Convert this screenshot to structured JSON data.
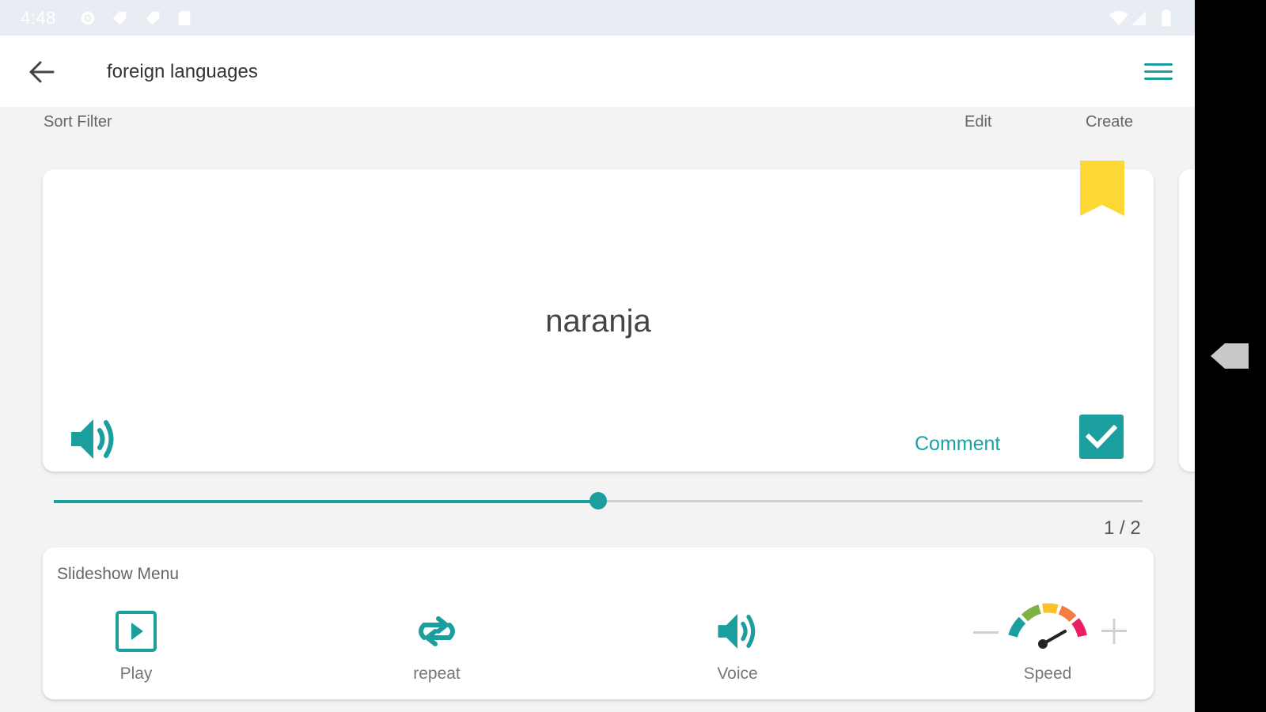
{
  "status_bar": {
    "time": "4:48",
    "icons": [
      "gear-icon",
      "tag-icon",
      "tag-icon",
      "sd-card-icon",
      "wifi-icon",
      "signal-icon",
      "battery-icon"
    ]
  },
  "app_bar": {
    "title": "foreign languages",
    "back_icon": "arrow-left-icon",
    "menu_icon": "hamburger-menu-icon"
  },
  "toolbar": {
    "sort_filter": "Sort Filter",
    "edit": "Edit",
    "create": "Create"
  },
  "card": {
    "word": "naranja",
    "comment_label": "Comment",
    "bookmarked": true,
    "checked": true
  },
  "progress": {
    "current": 1,
    "total": 2,
    "label": "1 / 2",
    "position": 0.5
  },
  "slideshow_menu": {
    "title": "Slideshow Menu",
    "items": [
      {
        "label": "Play",
        "icon": "play-icon"
      },
      {
        "label": "repeat",
        "icon": "repeat-icon"
      },
      {
        "label": "Voice",
        "icon": "speaker-icon"
      }
    ],
    "speed": {
      "label": "Speed",
      "icon": "speedometer-icon"
    }
  },
  "colors": {
    "accent": "#1b9e9e",
    "bookmark": "#fdd835",
    "background": "#f3f3f3",
    "card": "#ffffff"
  }
}
